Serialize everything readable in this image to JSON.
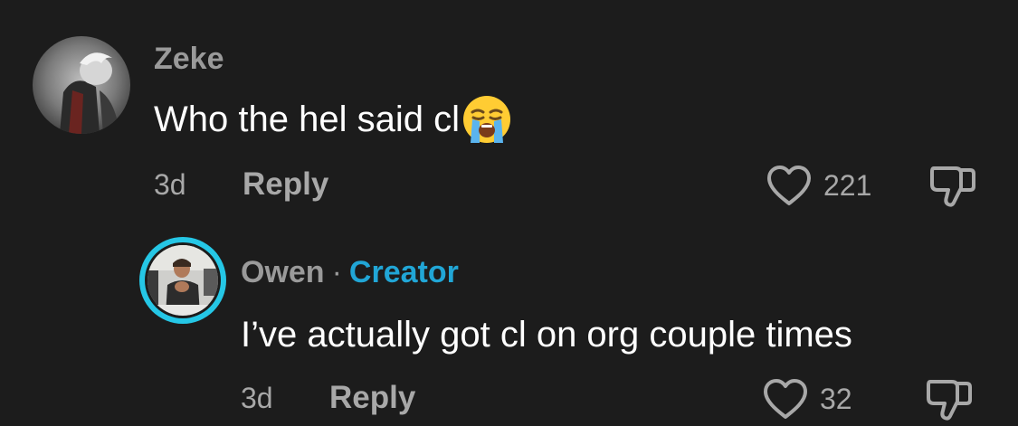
{
  "comments": [
    {
      "username": "Zeke",
      "text": "Who the hel said cl",
      "emoji": "loudly-crying-face",
      "time": "3d",
      "reply_label": "Reply",
      "likes": "221"
    }
  ],
  "reply": {
    "username": "Owen",
    "separator": "·",
    "badge": "Creator",
    "text": "I’ve actually got cl on org couple times",
    "time": "3d",
    "reply_label": "Reply",
    "likes": "32"
  },
  "colors": {
    "background": "#1c1c1c",
    "username": "#9a9a9a",
    "creator_badge": "#21a6d6",
    "meta_text": "#a8a8a8",
    "creator_ring": "#25c7e6"
  }
}
